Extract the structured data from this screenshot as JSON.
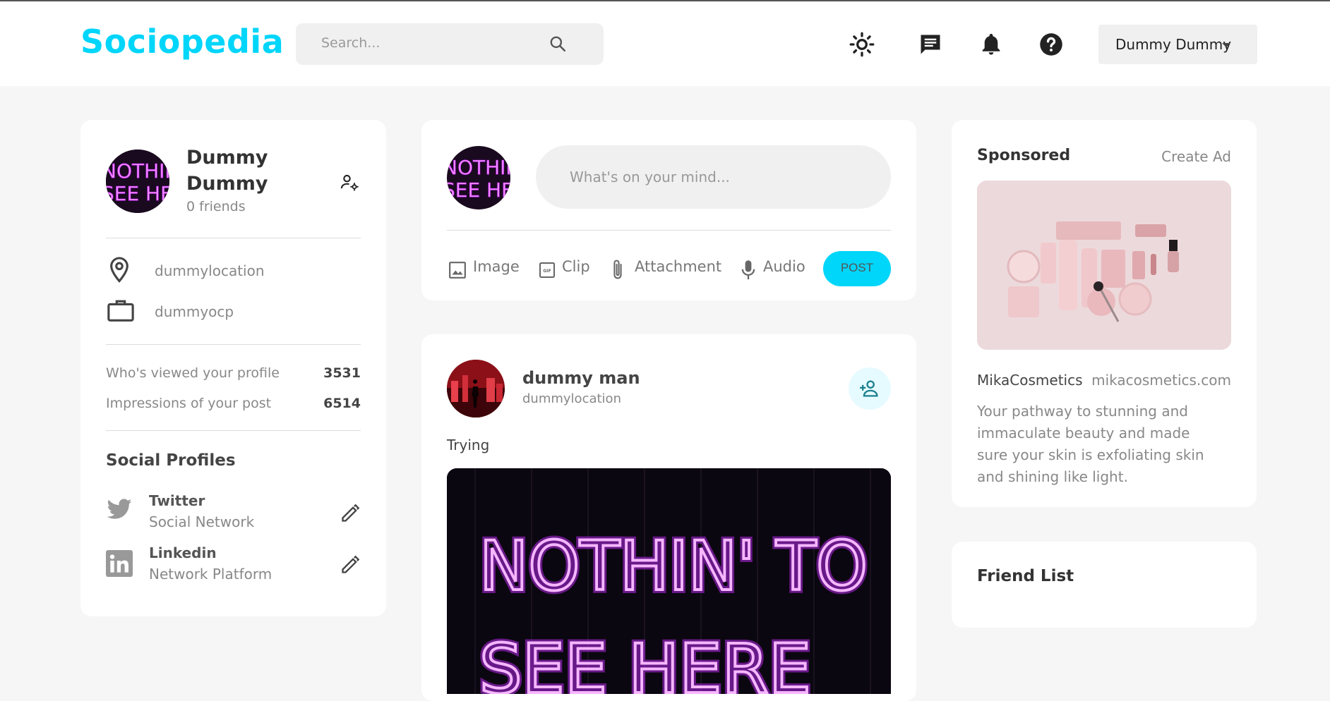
{
  "app": {
    "logo": "Sociopedia"
  },
  "search": {
    "placeholder": "Search..."
  },
  "nav": {
    "icons": [
      "light-mode-icon",
      "message-icon",
      "notifications-icon",
      "help-icon"
    ],
    "user_select": "Dummy Dummy"
  },
  "colors": {
    "accent": "#00d5fa",
    "background": "#f6f6f6",
    "card": "#ffffff"
  },
  "profile": {
    "name": "Dummy Dummy",
    "friends": "0 friends",
    "location": "dummylocation",
    "occupation": "dummyocp",
    "stats": [
      {
        "label": "Who's viewed your profile",
        "value": "3531"
      },
      {
        "label": "Impressions of your post",
        "value": "6514"
      }
    ],
    "social_title": "Social Profiles",
    "social": [
      {
        "name": "Twitter",
        "type": "Social Network",
        "icon": "twitter-icon"
      },
      {
        "name": "Linkedin",
        "type": "Network Platform",
        "icon": "linkedin-icon"
      }
    ],
    "avatar_text": [
      "NOTHIN' TO",
      "SEE HERE"
    ]
  },
  "composer": {
    "placeholder": "What's on your mind...",
    "actions": [
      "Image",
      "Clip",
      "Attachment",
      "Audio"
    ],
    "post_label": "POST"
  },
  "feed": {
    "post": {
      "author": "dummy man",
      "location": "dummylocation",
      "description": "Trying",
      "image_text": [
        "NOTHIN' TO",
        "SEE HERE"
      ]
    }
  },
  "sponsored": {
    "title": "Sponsored",
    "create_label": "Create Ad",
    "brand": "MikaCosmetics",
    "url": "mikacosmetics.com",
    "description": "Your pathway to stunning and immaculate beauty and made sure your skin is exfoliating skin and shining like light."
  },
  "friend_list": {
    "title": "Friend List"
  }
}
